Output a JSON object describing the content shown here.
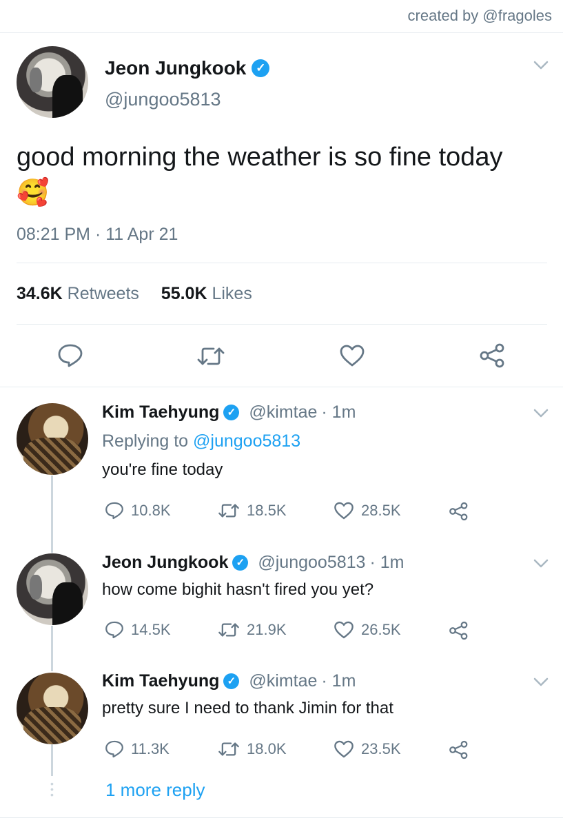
{
  "credit": "created by @fragoles",
  "main_tweet": {
    "name": "Jeon Jungkook",
    "handle": "@jungoo5813",
    "text": "good morning the weather is so fine today",
    "emoji": "🥰",
    "timestamp": "08:21 PM · 11 Apr 21",
    "retweets_count": "34.6K",
    "retweets_label": "Retweets",
    "likes_count": "55.0K",
    "likes_label": "Likes"
  },
  "replies": [
    {
      "name": "Kim Taehyung",
      "handle": "@kimtae",
      "time": "· 1m",
      "replying_prefix": "Replying to",
      "replying_handle": "@jungoo5813",
      "text": "you're fine today",
      "comments": "10.8K",
      "retweets": "18.5K",
      "likes": "28.5K"
    },
    {
      "name": "Jeon Jungkook",
      "handle": "@jungoo5813",
      "time": "· 1m",
      "text": "how come bighit hasn't fired you yet?",
      "comments": "14.5K",
      "retweets": "21.9K",
      "likes": "26.5K"
    },
    {
      "name": "Kim Taehyung",
      "handle": "@kimtae",
      "time": "· 1m",
      "text": "pretty sure I need to thank Jimin for that",
      "comments": "11.3K",
      "retweets": "18.0K",
      "likes": "23.5K"
    }
  ],
  "more_replies": "1 more reply",
  "colors": {
    "accent": "#1da1f2",
    "muted": "#657786",
    "divider": "#e6ecf0"
  }
}
